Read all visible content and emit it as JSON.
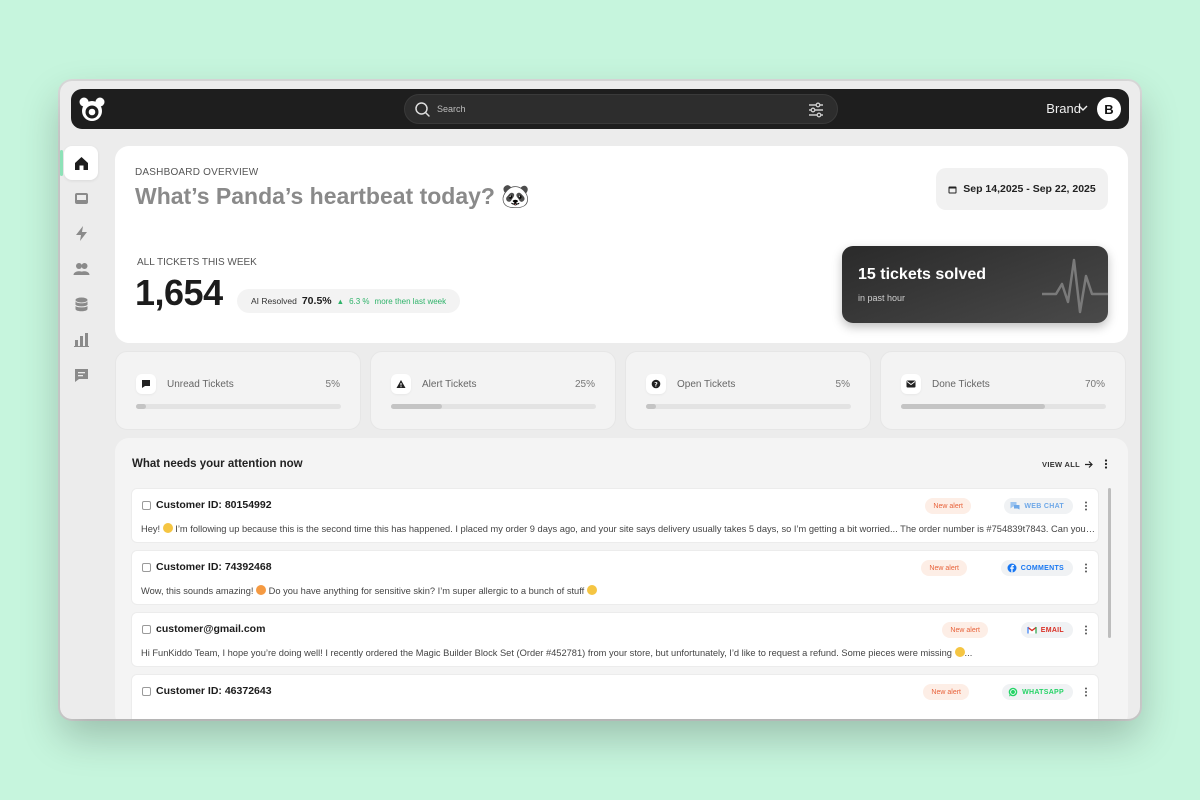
{
  "search": {
    "placeholder": "Search"
  },
  "header": {
    "brand": "Brand",
    "avatar_initial": "B"
  },
  "sidebar": {
    "items": [
      {
        "icon": "home-icon",
        "active": true
      },
      {
        "icon": "inbox-icon",
        "active": false
      },
      {
        "icon": "lightning-icon",
        "active": false
      },
      {
        "icon": "users-icon",
        "active": false
      },
      {
        "icon": "database-icon",
        "active": false
      },
      {
        "icon": "chart-icon",
        "active": false
      },
      {
        "icon": "chat-icon",
        "active": false
      }
    ]
  },
  "hero": {
    "eyebrow": "DASHBOARD OVERVIEW",
    "title": "What’s Panda’s heartbeat today? 🐼",
    "date_range": "Sep 14,2025 - Sep 22, 2025",
    "tickets_label": "ALL TICKETS THIS WEEK",
    "tickets_count": "1,654",
    "ai_label": "AI Resolved",
    "ai_value": "70.5%",
    "ai_delta": "6.3 %",
    "ai_delta_text": "more then last week",
    "solved_title": "15 tickets solved",
    "solved_sub": "in past hour"
  },
  "stats": [
    {
      "label": "Unread Tickets",
      "percent": "5%",
      "fill": 0.05,
      "icon": "chat-bubble-icon"
    },
    {
      "label": "Alert Tickets",
      "percent": "25%",
      "fill": 0.25,
      "icon": "warning-icon"
    },
    {
      "label": "Open Tickets",
      "percent": "5%",
      "fill": 0.05,
      "icon": "help-circle-icon"
    },
    {
      "label": "Done Tickets",
      "percent": "70%",
      "fill": 0.7,
      "icon": "mail-check-icon"
    }
  ],
  "attention": {
    "title": "What needs your attention now",
    "view_all": "VIEW ALL",
    "tickets": [
      {
        "customer": "Customer ID: 80154992",
        "badge": "New alert",
        "channel": "WEB CHAT",
        "channel_color": "#6ea8e8",
        "message_a": "Hey! ",
        "message_b": " I’m following up because this is the second time this has happened. I placed my order 9 days ago, and your site says delivery usually takes 5 days, so I’m getting a bit worried... The order number is #754839t7843. Can you help me track it down?"
      },
      {
        "customer": "Customer ID: 74392468",
        "badge": "New alert",
        "channel": "COMMENTS",
        "channel_color": "#1877f2",
        "message_a": "Wow, this sounds amazing! ",
        "message_b": " Do you have anything for sensitive skin? I’m super allergic to a bunch of stuff "
      },
      {
        "customer": "customer@gmail.com",
        "badge": "New alert",
        "channel": "EMAIL",
        "channel_color": "#d93025",
        "message_a": "Hi FunKiddo Team, I hope you’re doing well! I recently ordered the Magic Builder Block Set (Order #452781) from your store, but unfortunately, I’d like to request a refund. Some pieces were missing ",
        "message_b": "..."
      },
      {
        "customer": "Customer ID: 46372643",
        "badge": "New alert",
        "channel": "WHATSAPP",
        "channel_color": "#25d366",
        "message_a": "",
        "message_b": ""
      }
    ]
  }
}
